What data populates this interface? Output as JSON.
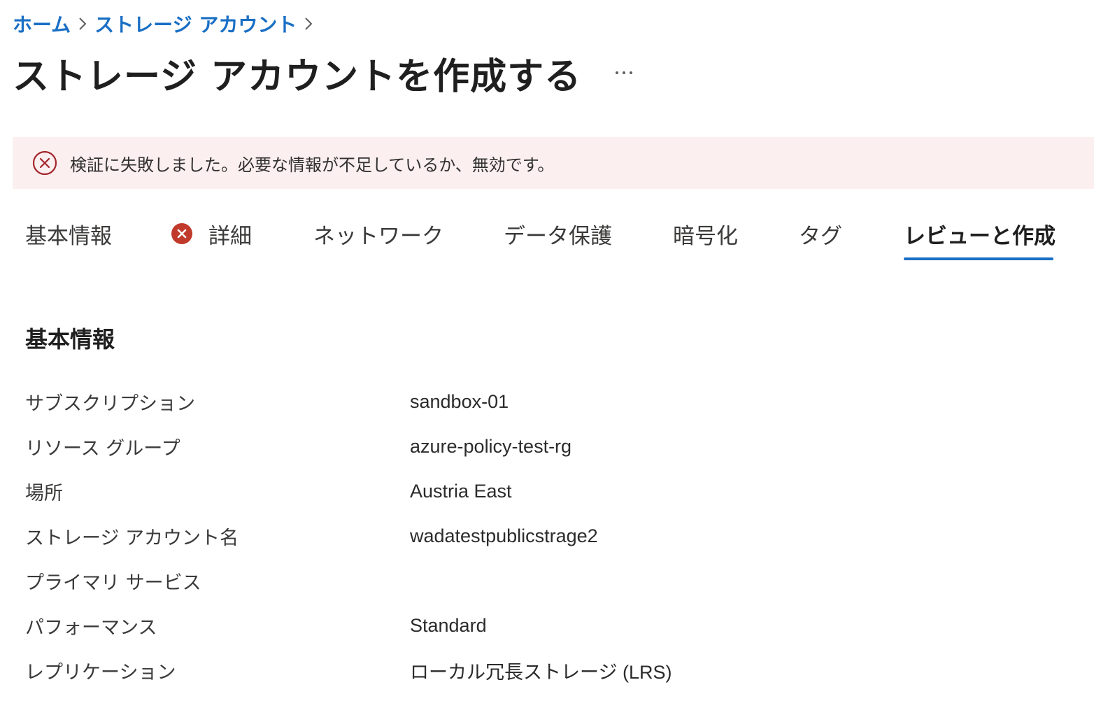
{
  "breadcrumb": {
    "items": [
      {
        "label": "ホーム"
      },
      {
        "label": "ストレージ アカウント"
      }
    ]
  },
  "page": {
    "title": "ストレージ アカウントを作成する",
    "more_label": "…"
  },
  "error_banner": {
    "icon": "error-circle-x-icon",
    "message": "検証に失敗しました。必要な情報が不足しているか、無効です。",
    "icon_color": "#a4262c",
    "background": "#fbefef"
  },
  "tabs": {
    "items": [
      {
        "label": "基本情報",
        "has_error": false,
        "active": false
      },
      {
        "label": "詳細",
        "has_error": true,
        "active": false
      },
      {
        "label": "ネットワーク",
        "has_error": false,
        "active": false
      },
      {
        "label": "データ保護",
        "has_error": false,
        "active": false
      },
      {
        "label": "暗号化",
        "has_error": false,
        "active": false
      },
      {
        "label": "タグ",
        "has_error": false,
        "active": false
      },
      {
        "label": "レビューと作成",
        "has_error": false,
        "active": true
      }
    ],
    "accent_color": "#1a6fc5",
    "error_icon_color": "#c0392b"
  },
  "section": {
    "title": "基本情報"
  },
  "summary": {
    "rows": [
      {
        "label": "サブスクリプション",
        "value": "sandbox-01"
      },
      {
        "label": "リソース グループ",
        "value": "azure-policy-test-rg"
      },
      {
        "label": "場所",
        "value": "Austria East"
      },
      {
        "label": "ストレージ アカウント名",
        "value": "wadatestpublicstrage2"
      },
      {
        "label": "プライマリ サービス",
        "value": ""
      },
      {
        "label": "パフォーマンス",
        "value": "Standard"
      },
      {
        "label": "レプリケーション",
        "value": "ローカル冗長ストレージ (LRS)"
      }
    ]
  }
}
